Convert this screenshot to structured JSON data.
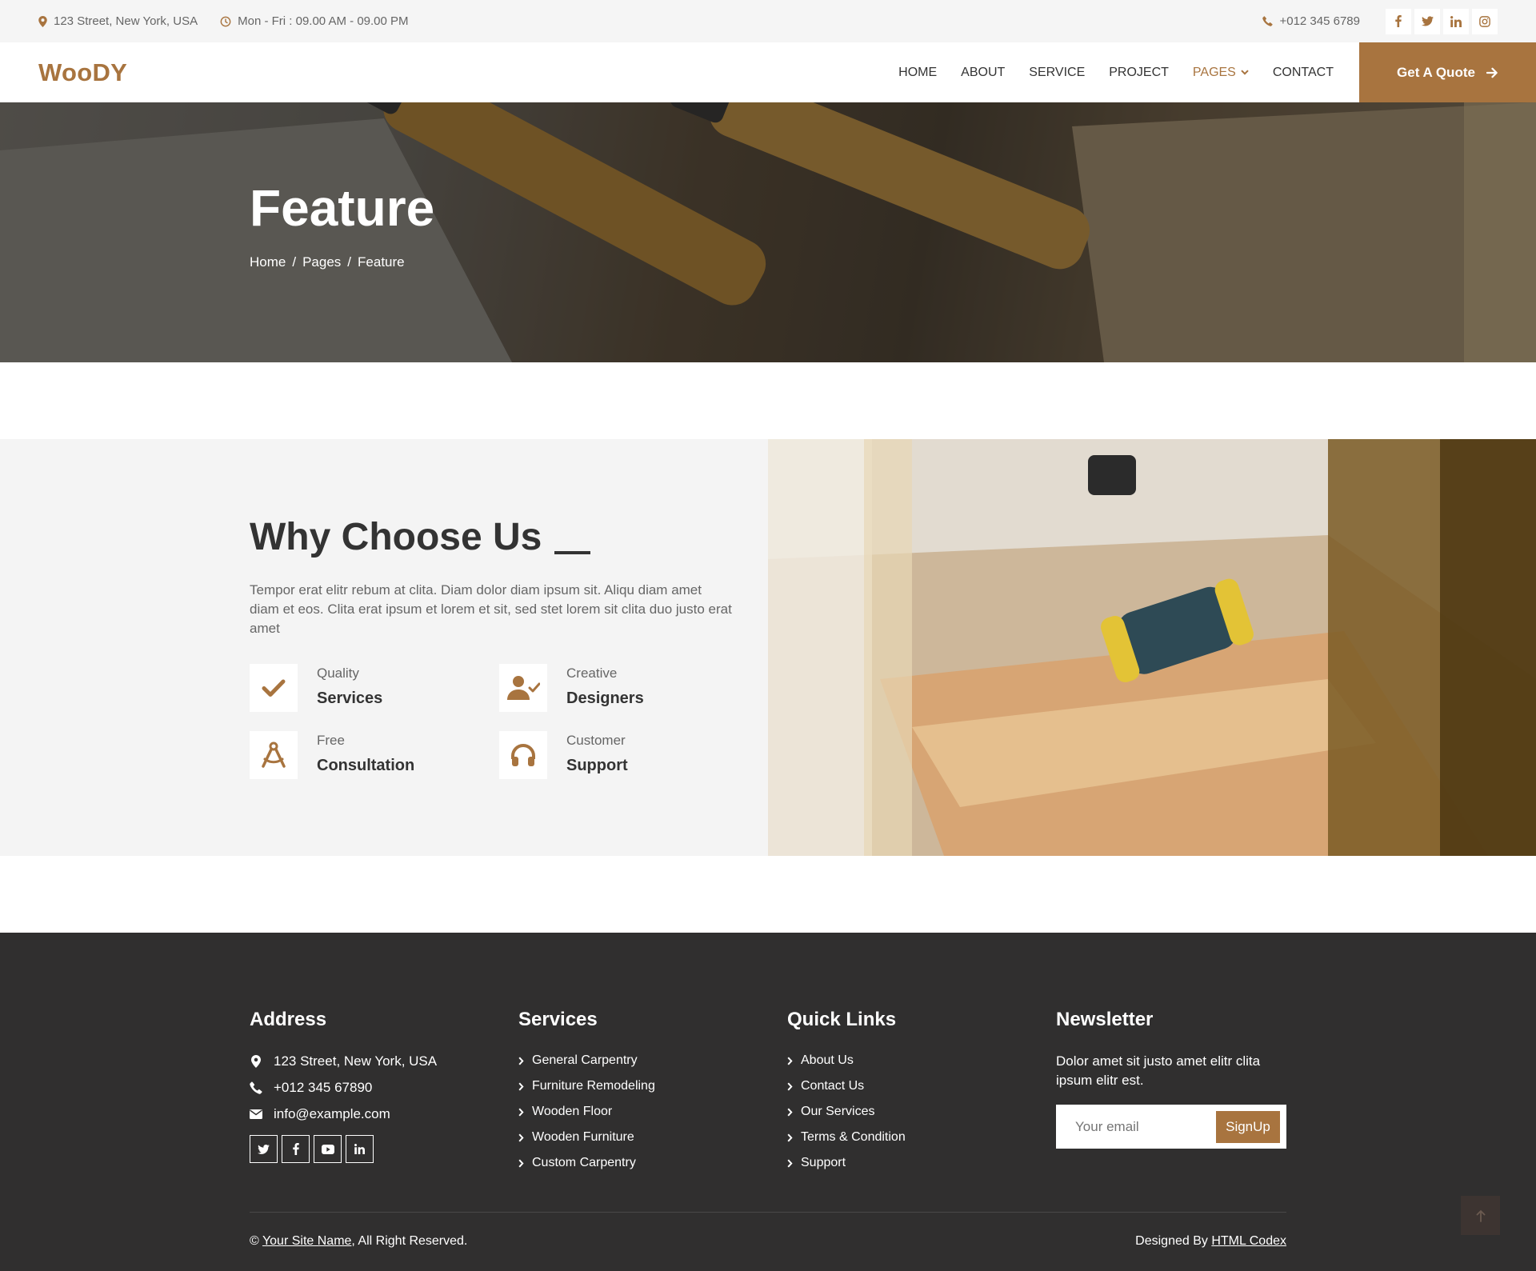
{
  "topbar": {
    "address": "123 Street, New York, USA",
    "hours": "Mon - Fri : 09.00 AM - 09.00 PM",
    "phone": "+012 345 6789"
  },
  "navbar": {
    "logo": "WooDY",
    "items": [
      "HOME",
      "ABOUT",
      "SERVICE",
      "PROJECT",
      "PAGES",
      "CONTACT"
    ],
    "active_item": "PAGES",
    "quote_button": "Get A Quote"
  },
  "hero": {
    "title": "Feature",
    "breadcrumb": [
      "Home",
      "Pages",
      "Feature"
    ]
  },
  "feature": {
    "title": "Why Choose Us",
    "description": "Tempor erat elitr rebum at clita. Diam dolor diam ipsum sit. Aliqu diam amet diam et eos. Clita erat ipsum et lorem et sit, sed stet lorem sit clita duo justo erat amet",
    "items": [
      {
        "small": "Quality",
        "big": "Services",
        "icon": "check-icon"
      },
      {
        "small": "Creative",
        "big": "Designers",
        "icon": "user-check-icon"
      },
      {
        "small": "Free",
        "big": "Consultation",
        "icon": "drafting-compass-icon"
      },
      {
        "small": "Customer",
        "big": "Support",
        "icon": "headphones-icon"
      }
    ]
  },
  "footer": {
    "address": {
      "title": "Address",
      "street": "123 Street, New York, USA",
      "phone": "+012 345 67890",
      "email": "info@example.com"
    },
    "services": {
      "title": "Services",
      "links": [
        "General Carpentry",
        "Furniture Remodeling",
        "Wooden Floor",
        "Wooden Furniture",
        "Custom Carpentry"
      ]
    },
    "quick_links": {
      "title": "Quick Links",
      "links": [
        "About Us",
        "Contact Us",
        "Our Services",
        "Terms & Condition",
        "Support"
      ]
    },
    "newsletter": {
      "title": "Newsletter",
      "description": "Dolor amet sit justo amet elitr clita ipsum elitr est.",
      "placeholder": "Your email",
      "button": "SignUp"
    },
    "copyright_prefix": "©",
    "site_name": "Your Site Name",
    "copyright_suffix": ", All Right Reserved.",
    "credit_prefix": "Designed By",
    "credit_link": "HTML Codex"
  },
  "colors": {
    "accent": "#a8743f",
    "footer_bg": "#302f2f",
    "topbar_bg": "#f5f5f5",
    "feature_bg": "#f4f4f4"
  }
}
